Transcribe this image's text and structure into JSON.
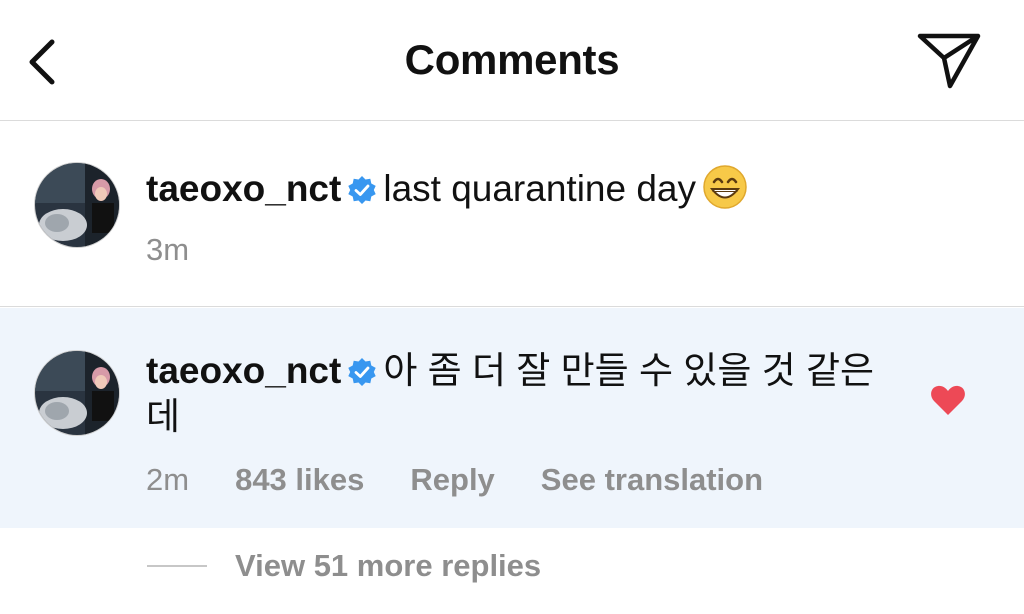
{
  "header": {
    "title": "Comments",
    "back_icon": "chevron-left-icon",
    "share_icon": "paper-plane-icon"
  },
  "comments": [
    {
      "username": "taeoxo_nct",
      "verified": true,
      "text": "last quarantine day",
      "emoji": "grinning-face-emoji",
      "time": "3m"
    },
    {
      "username": "taeoxo_nct",
      "verified": true,
      "text": "아 좀 더 잘 만들 수 있을 것 같은데",
      "time": "2m",
      "likes": "843 likes",
      "reply_label": "Reply",
      "translate_label": "See translation",
      "liked": true
    }
  ],
  "view_more_label": "View 51 more replies",
  "colors": {
    "verified_blue": "#3897f0",
    "heart_red": "#ed4956",
    "highlight_bg": "#eff5fc",
    "secondary_text": "#8e8e8e"
  }
}
